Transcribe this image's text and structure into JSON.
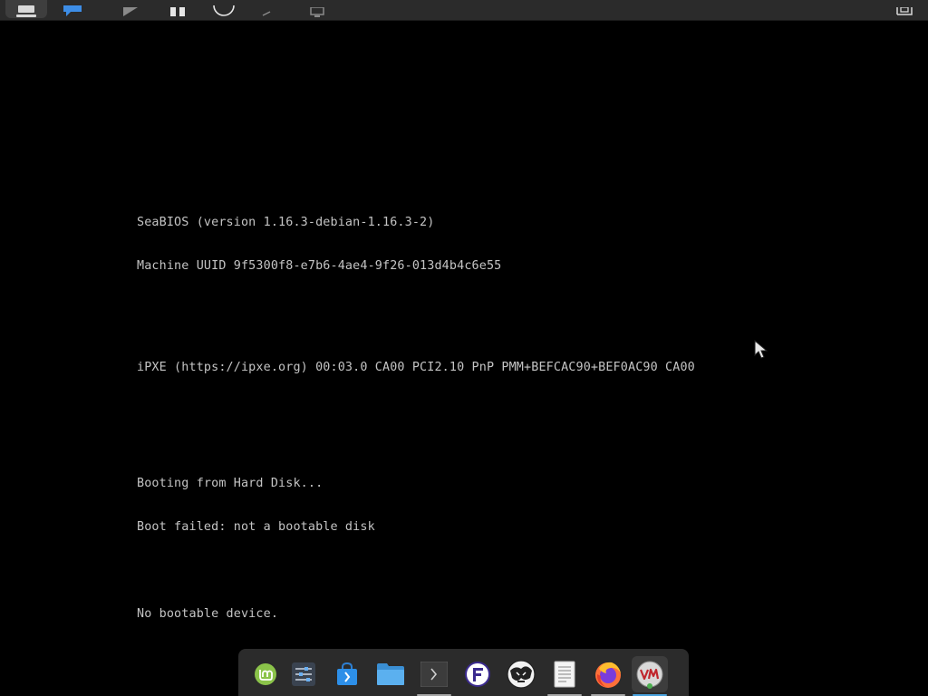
{
  "toolbar": {
    "buttons": [
      "menu-icon",
      "chat-icon",
      "play-icon",
      "pause-icon",
      "power-icon",
      "arrow-icon",
      "monitor-icon",
      "fullscreen-icon"
    ]
  },
  "console": {
    "lines": [
      "SeaBIOS (version 1.16.3-debian-1.16.3-2)",
      "Machine UUID 9f5300f8-e7b6-4ae4-9f26-013d4b4c6e55",
      "iPXE (https://ipxe.org) 00:03.0 CA00 PCI2.10 PnP PMM+BEFCAC90+BEF0AC90 CA00",
      "Booting from Hard Disk...",
      "Boot failed: not a bootable disk",
      "No bootable device."
    ]
  },
  "dock": {
    "items": [
      {
        "name": "mint-menu-icon",
        "running": false
      },
      {
        "name": "settings-icon",
        "running": false
      },
      {
        "name": "software-store-icon",
        "running": false
      },
      {
        "name": "files-icon",
        "running": false
      },
      {
        "name": "terminal-icon",
        "running": true
      },
      {
        "name": "f-app-icon",
        "running": false
      },
      {
        "name": "globe-app-icon",
        "running": false
      },
      {
        "name": "text-editor-icon",
        "running": true
      },
      {
        "name": "firefox-icon",
        "running": true
      },
      {
        "name": "virt-manager-icon",
        "running": true,
        "active": true
      }
    ]
  },
  "colors": {
    "console_text": "#c4c4c4",
    "background": "#000000",
    "panel": "#2b2b2b",
    "mint_green": "#8bc34a",
    "running_blue": "#4aa3df"
  }
}
